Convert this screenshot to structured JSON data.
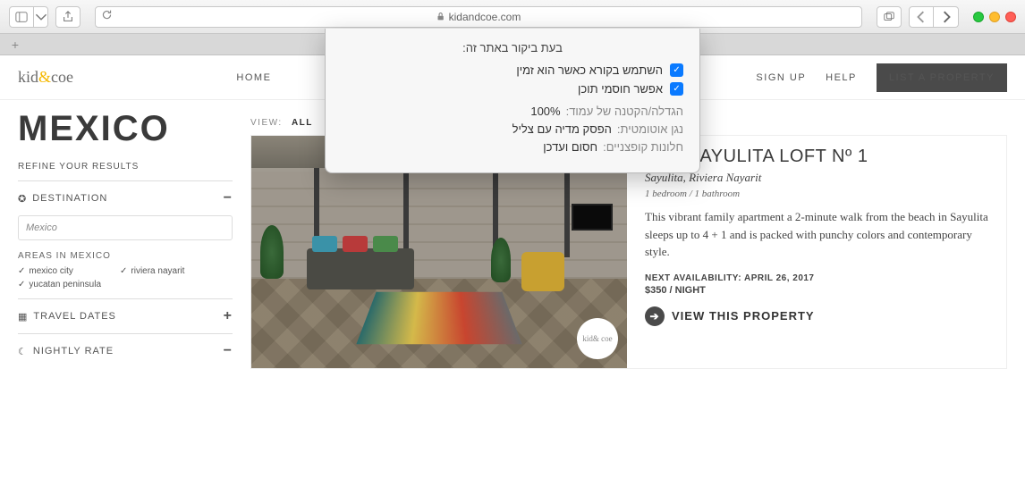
{
  "browser": {
    "url_display": "kidandcoe.com"
  },
  "popover": {
    "title": "בעת ביקור באתר זה:",
    "checks": [
      {
        "label": "השתמש בקורא כאשר הוא זמין"
      },
      {
        "label": "אפשר חוסמי תוכן"
      }
    ],
    "rows": [
      {
        "key": "הגדלה/הקטנה של עמוד:",
        "value": "100%"
      },
      {
        "key": "נגן אוטומטית:",
        "value": "הפסק מדיה עם צליל"
      },
      {
        "key": "חלונות קופצניים:",
        "value": "חסום ועדכן"
      }
    ]
  },
  "site": {
    "logo_a": "kid",
    "logo_amp": "&",
    "logo_b": "coe",
    "nav_home": "HOME",
    "nav_signup": "SIGN UP",
    "nav_help": "HELP",
    "cta": "LIST A PROPERTY"
  },
  "page": {
    "title": "MEXICO",
    "refine": "REFINE YOUR RESULTS",
    "view_label": "VIEW:",
    "view_active": "ALL"
  },
  "filters": {
    "destination": {
      "label": "DESTINATION",
      "input_value": "Mexico",
      "areas_label": "AREAS IN MEXICO",
      "areas": [
        "mexico city",
        "riviera nayarit",
        "yucatan peninsula"
      ]
    },
    "travel_dates": {
      "label": "TRAVEL DATES"
    },
    "nightly_rate": {
      "label": "NIGHTLY RATE"
    }
  },
  "listing": {
    "title": "THE SAYULITA LOFT Nº 1",
    "location": "Sayulita, Riviera Nayarit",
    "meta": "1 bedroom / 1 bathroom",
    "description": "This vibrant family apartment a 2-minute walk from the beach in Sayulita sleeps up to 4 + 1 and is packed with punchy colors and contemporary style.",
    "availability": "NEXT AVAILABILITY: APRIL 26, 2017",
    "price": "$350 / NIGHT",
    "view_link": "VIEW THIS PROPERTY",
    "badge": "kid& coe"
  }
}
